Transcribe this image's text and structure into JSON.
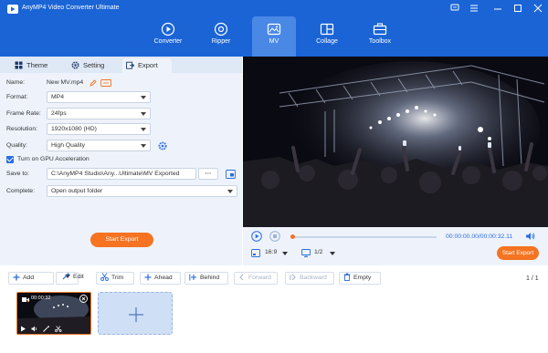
{
  "app": {
    "title": "AnyMP4 Video Converter Ultimate"
  },
  "nav": [
    {
      "label": "Converter",
      "icon": "converter-icon",
      "active": false
    },
    {
      "label": "Ripper",
      "icon": "ripper-icon",
      "active": false
    },
    {
      "label": "MV",
      "icon": "mv-icon",
      "active": true
    },
    {
      "label": "Collage",
      "icon": "collage-icon",
      "active": false
    },
    {
      "label": "Toolbox",
      "icon": "toolbox-icon",
      "active": false
    }
  ],
  "tabs": {
    "theme": "Theme",
    "setting": "Setting",
    "export": "Export"
  },
  "export": {
    "name_label": "Name:",
    "name_value": "New MV.mp4",
    "format_label": "Format:",
    "format_value": "MP4",
    "framerate_label": "Frame Rate:",
    "framerate_value": "24fps",
    "resolution_label": "Resolution:",
    "resolution_value": "1920x1080 (HD)",
    "quality_label": "Quality:",
    "quality_value": "High Quality",
    "gpu_label": "Turn on GPU Acceleration",
    "gpu_checked": true,
    "saveto_label": "Save to:",
    "saveto_value": "C:\\AnyMP4 Studio\\Any...Ultimate\\MV Exported",
    "saveto_more": "···",
    "complete_label": "Complete:",
    "complete_value": "Open output folder",
    "start_button": "Start Export"
  },
  "player": {
    "time": "00:00:00.00/00:00:32.11",
    "aspect": "16:9",
    "pages": "1/2",
    "start_button": "Start Export",
    "progress": 0.0
  },
  "toolbar": {
    "add": "Add",
    "edit": "Edit",
    "trim": "Trim",
    "ahead": "Ahead",
    "behind": "Behind",
    "forward": "Forward",
    "backward": "Backward",
    "empty": "Empty",
    "pager": "1 / 1"
  },
  "clip": {
    "duration": "00:00:32"
  },
  "colors": {
    "brand": "#1a64d6",
    "accent": "#f57321",
    "panel": "#eef3fb"
  }
}
